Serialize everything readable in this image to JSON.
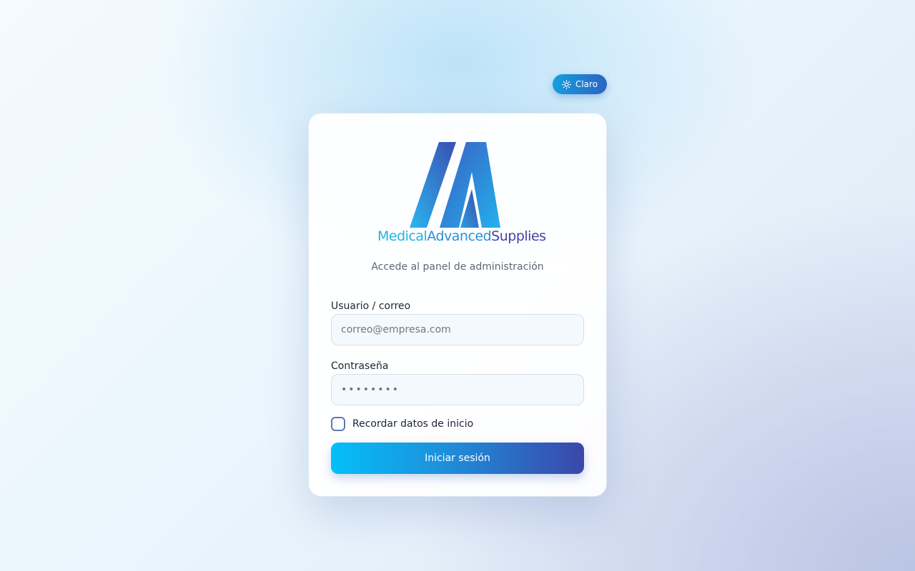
{
  "theme_toggle": {
    "label": "Claro",
    "icon": "sun-icon"
  },
  "brand": {
    "logo_text": [
      "Medical",
      "Advanced",
      "Supplies"
    ],
    "colors": {
      "medical": "#22b3dc",
      "advanced": "#2b8fd6",
      "supplies": "#4a3fa3"
    }
  },
  "login": {
    "subtitle": "Accede al panel de administración",
    "username": {
      "label": "Usuario / correo",
      "placeholder": "correo@empresa.com",
      "value": ""
    },
    "password": {
      "label": "Contraseña",
      "placeholder": "••••••••",
      "value": ""
    },
    "remember": {
      "label": "Recordar datos de inicio",
      "checked": false
    },
    "submit_label": "Iniciar sesión"
  },
  "colors": {
    "accent_start": "#05bff8",
    "accent_end": "#3b47aa"
  }
}
